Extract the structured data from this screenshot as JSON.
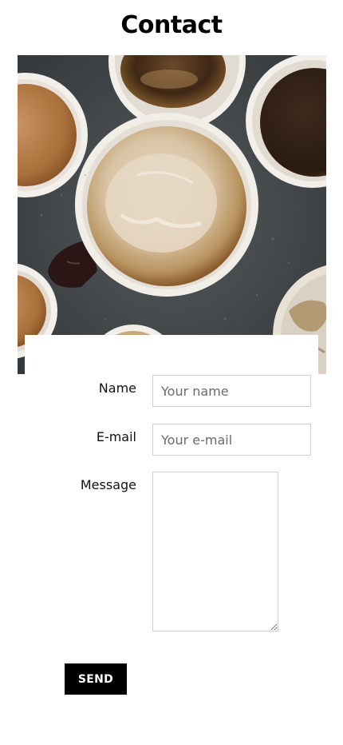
{
  "page": {
    "title": "Contact"
  },
  "hero": {
    "image": "coffee-cups-photo"
  },
  "form": {
    "name_label": "Name",
    "name_placeholder": "Your name",
    "name_value": "",
    "email_label": "E-mail",
    "email_placeholder": "Your e-mail",
    "email_value": "",
    "message_label": "Message",
    "message_value": "",
    "send_label": "SEND"
  },
  "colors": {
    "button_bg": "#000000",
    "button_text": "#ffffff",
    "field_border": "#cfcfcf",
    "table_surface": "#45494b"
  }
}
